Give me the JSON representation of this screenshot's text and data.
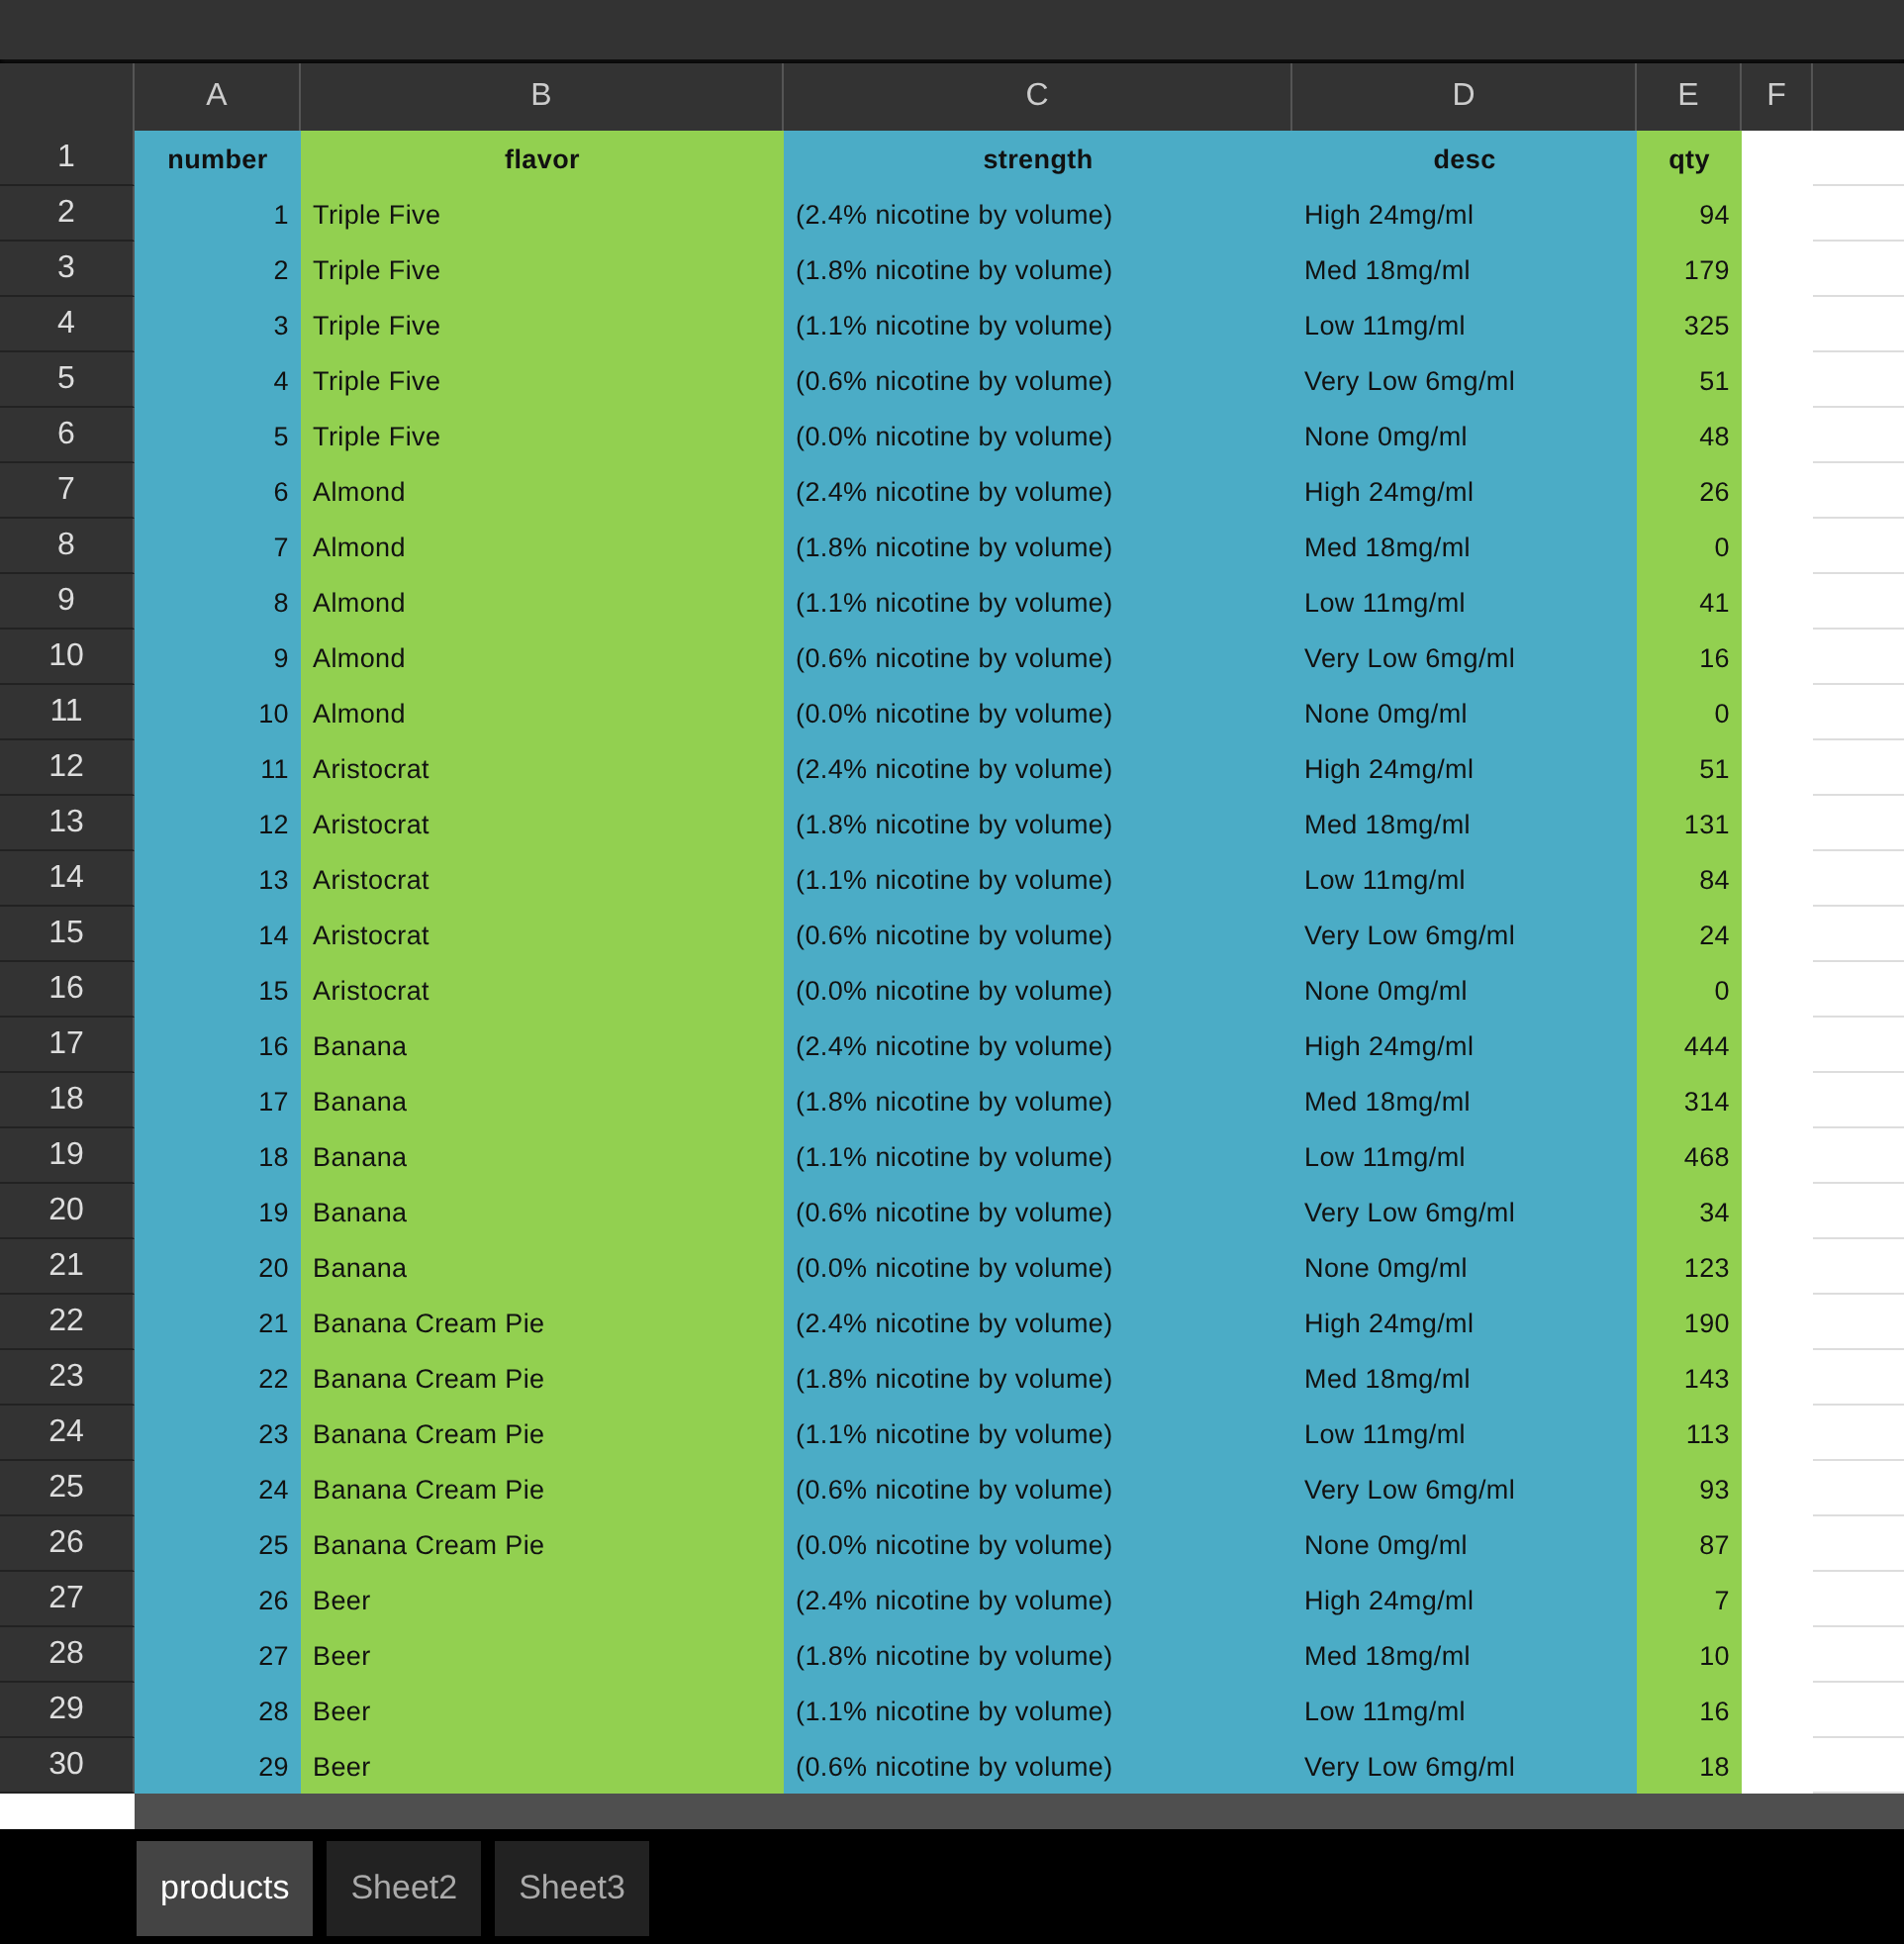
{
  "columns": [
    {
      "letter": "A",
      "color": "#4bacc6",
      "kind": "number"
    },
    {
      "letter": "B",
      "color": "#92d050",
      "kind": "text"
    },
    {
      "letter": "C",
      "color": "#4bacc6",
      "kind": "text"
    },
    {
      "letter": "D",
      "color": "#4bacc6",
      "kind": "text"
    },
    {
      "letter": "E",
      "color": "#92d050",
      "kind": "number"
    },
    {
      "letter": "F"
    }
  ],
  "rows": [
    {
      "num": "1",
      "kind": "header",
      "cells": [
        "number",
        "flavor",
        "strength",
        "desc",
        "qty"
      ]
    },
    {
      "num": "2",
      "kind": "data",
      "cells": [
        "1",
        "Triple Five",
        "(2.4% nicotine by volume)",
        "High 24mg/ml",
        "94"
      ]
    },
    {
      "num": "3",
      "kind": "data",
      "cells": [
        "2",
        "Triple Five",
        "(1.8% nicotine by volume)",
        "Med 18mg/ml",
        "179"
      ]
    },
    {
      "num": "4",
      "kind": "data",
      "cells": [
        "3",
        "Triple Five",
        "(1.1% nicotine by volume)",
        "Low 11mg/ml",
        "325"
      ]
    },
    {
      "num": "5",
      "kind": "data",
      "cells": [
        "4",
        "Triple Five",
        "(0.6% nicotine by volume)",
        "Very Low 6mg/ml",
        "51"
      ]
    },
    {
      "num": "6",
      "kind": "data",
      "cells": [
        "5",
        "Triple Five",
        "(0.0% nicotine by volume)",
        "None 0mg/ml",
        "48"
      ]
    },
    {
      "num": "7",
      "kind": "data",
      "cells": [
        "6",
        "Almond",
        "(2.4% nicotine by volume)",
        "High 24mg/ml",
        "26"
      ]
    },
    {
      "num": "8",
      "kind": "data",
      "cells": [
        "7",
        "Almond",
        "(1.8% nicotine by volume)",
        "Med 18mg/ml",
        "0"
      ]
    },
    {
      "num": "9",
      "kind": "data",
      "cells": [
        "8",
        "Almond",
        "(1.1% nicotine by volume)",
        "Low 11mg/ml",
        "41"
      ]
    },
    {
      "num": "10",
      "kind": "data",
      "cells": [
        "9",
        "Almond",
        "(0.6% nicotine by volume)",
        "Very Low 6mg/ml",
        "16"
      ]
    },
    {
      "num": "11",
      "kind": "data",
      "cells": [
        "10",
        "Almond",
        "(0.0% nicotine by volume)",
        "None 0mg/ml",
        "0"
      ]
    },
    {
      "num": "12",
      "kind": "data",
      "cells": [
        "11",
        "Aristocrat",
        "(2.4% nicotine by volume)",
        "High 24mg/ml",
        "51"
      ]
    },
    {
      "num": "13",
      "kind": "data",
      "cells": [
        "12",
        "Aristocrat",
        "(1.8% nicotine by volume)",
        "Med 18mg/ml",
        "131"
      ]
    },
    {
      "num": "14",
      "kind": "data",
      "cells": [
        "13",
        "Aristocrat",
        "(1.1% nicotine by volume)",
        "Low 11mg/ml",
        "84"
      ]
    },
    {
      "num": "15",
      "kind": "data",
      "cells": [
        "14",
        "Aristocrat",
        "(0.6% nicotine by volume)",
        "Very Low 6mg/ml",
        "24"
      ]
    },
    {
      "num": "16",
      "kind": "data",
      "cells": [
        "15",
        "Aristocrat",
        "(0.0% nicotine by volume)",
        "None 0mg/ml",
        "0"
      ]
    },
    {
      "num": "17",
      "kind": "data",
      "cells": [
        "16",
        "Banana",
        "(2.4% nicotine by volume)",
        "High 24mg/ml",
        "444"
      ]
    },
    {
      "num": "18",
      "kind": "data",
      "cells": [
        "17",
        "Banana",
        "(1.8% nicotine by volume)",
        "Med 18mg/ml",
        "314"
      ]
    },
    {
      "num": "19",
      "kind": "data",
      "cells": [
        "18",
        "Banana",
        "(1.1% nicotine by volume)",
        "Low 11mg/ml",
        "468"
      ]
    },
    {
      "num": "20",
      "kind": "data",
      "cells": [
        "19",
        "Banana",
        "(0.6% nicotine by volume)",
        "Very Low 6mg/ml",
        "34"
      ]
    },
    {
      "num": "21",
      "kind": "data",
      "cells": [
        "20",
        "Banana",
        "(0.0% nicotine by volume)",
        "None 0mg/ml",
        "123"
      ]
    },
    {
      "num": "22",
      "kind": "data",
      "cells": [
        "21",
        "Banana Cream Pie",
        "(2.4% nicotine by volume)",
        "High 24mg/ml",
        "190"
      ]
    },
    {
      "num": "23",
      "kind": "data",
      "cells": [
        "22",
        "Banana Cream Pie",
        "(1.8% nicotine by volume)",
        "Med 18mg/ml",
        "143"
      ]
    },
    {
      "num": "24",
      "kind": "data",
      "cells": [
        "23",
        "Banana Cream Pie",
        "(1.1% nicotine by volume)",
        "Low 11mg/ml",
        "113"
      ]
    },
    {
      "num": "25",
      "kind": "data",
      "cells": [
        "24",
        "Banana Cream Pie",
        "(0.6% nicotine by volume)",
        "Very Low 6mg/ml",
        "93"
      ]
    },
    {
      "num": "26",
      "kind": "data",
      "cells": [
        "25",
        "Banana Cream Pie",
        "(0.0% nicotine by volume)",
        "None 0mg/ml",
        "87"
      ]
    },
    {
      "num": "27",
      "kind": "data",
      "cells": [
        "26",
        "Beer",
        "(2.4% nicotine by volume)",
        "High 24mg/ml",
        "7"
      ]
    },
    {
      "num": "28",
      "kind": "data",
      "cells": [
        "27",
        "Beer",
        "(1.8% nicotine by volume)",
        "Med 18mg/ml",
        "10"
      ]
    },
    {
      "num": "29",
      "kind": "data",
      "cells": [
        "28",
        "Beer",
        "(1.1% nicotine by volume)",
        "Low 11mg/ml",
        "16"
      ]
    },
    {
      "num": "30",
      "kind": "data",
      "cells": [
        "29",
        "Beer",
        "(0.6% nicotine by volume)",
        "Very Low 6mg/ml",
        "18"
      ]
    }
  ],
  "sheet_tabs": [
    {
      "label": "products",
      "selected": true
    },
    {
      "label": "Sheet2",
      "selected": false
    },
    {
      "label": "Sheet3",
      "selected": false
    }
  ]
}
